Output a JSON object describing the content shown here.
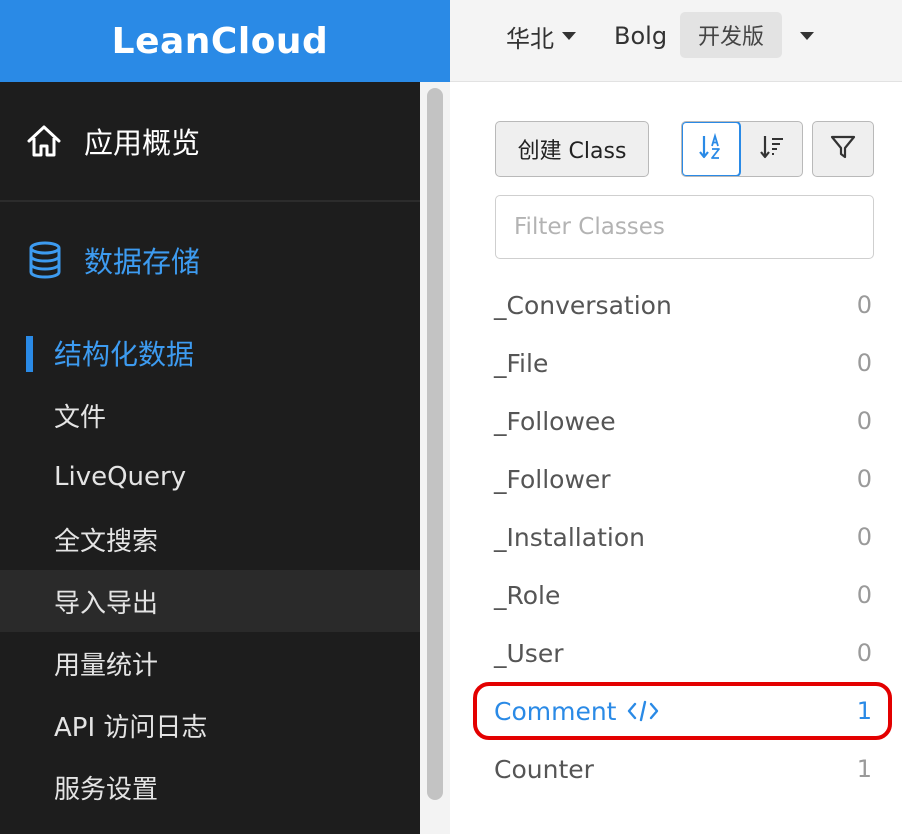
{
  "brand": "LeanCloud",
  "sidebar": {
    "overview": "应用概览",
    "storage": "数据存储",
    "sub_items": [
      "结构化数据",
      "文件",
      "LiveQuery",
      "全文搜索",
      "导入导出",
      "用量统计",
      "API 访问日志",
      "服务设置"
    ],
    "active_index": 0,
    "hover_index": 4
  },
  "topbar": {
    "region": "华北",
    "app": "Bolg",
    "plan": "开发版"
  },
  "toolbar": {
    "create_label": "创建 Class",
    "filter_placeholder": "Filter Classes"
  },
  "classes": [
    {
      "name": "_Conversation",
      "count": "0"
    },
    {
      "name": "_File",
      "count": "0"
    },
    {
      "name": "_Followee",
      "count": "0"
    },
    {
      "name": "_Follower",
      "count": "0"
    },
    {
      "name": "_Installation",
      "count": "0"
    },
    {
      "name": "_Role",
      "count": "0"
    },
    {
      "name": "_User",
      "count": "0"
    },
    {
      "name": "Comment",
      "count": "1"
    },
    {
      "name": "Counter",
      "count": "1"
    }
  ],
  "colors": {
    "accent": "#2a8ae6",
    "sidebar_bg": "#1d1d1d",
    "highlight_ring": "#e30000"
  },
  "icons": {
    "overview": "home-icon",
    "storage": "database-icon",
    "sort_az": "sort-alpha-icon",
    "sort_count": "sort-amount-icon",
    "filter": "filter-icon",
    "code": "code-icon"
  }
}
